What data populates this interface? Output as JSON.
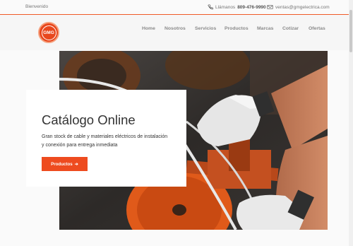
{
  "topbar": {
    "welcome": "Bienvenido",
    "phone_prefix": "Llámanos",
    "phone_number": "809-476-9990",
    "email": "ventas@gmgelectrica.com"
  },
  "logo": {
    "text": "GMG"
  },
  "nav": {
    "items": [
      "Home",
      "Nosotros",
      "Servicios",
      "Productos",
      "Marcas",
      "Cotizar",
      "Ofertas"
    ]
  },
  "hero": {
    "title": "Catálogo Online",
    "description": "Gran stock de cable y materiales eléctricos de instalación y conexión para entrega inmediata",
    "button_label": "Productos",
    "button_arrow": "➔"
  },
  "colors": {
    "accent": "#ee4b1f",
    "text": "#333333",
    "muted": "#8a8a8a"
  },
  "icons": {
    "phone": "phone-icon",
    "mail": "mail-icon",
    "button": "arrow-right-icon"
  }
}
